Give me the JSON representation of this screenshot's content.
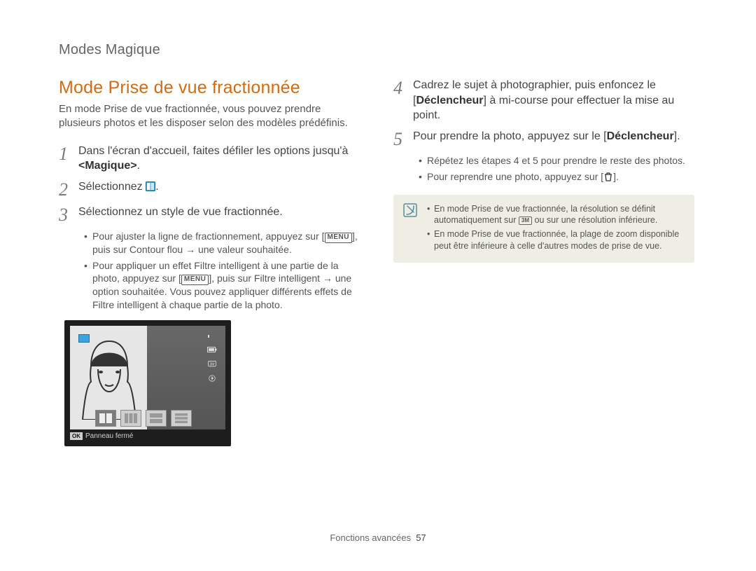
{
  "breadcrumb": "Modes Magique",
  "title": "Mode Prise de vue fractionnée",
  "intro": "En mode Prise de vue fractionnée, vous pouvez prendre plusieurs photos et les disposer selon des modèles prédéfinis.",
  "left": {
    "step1": {
      "pre": "Dans l'écran d'accueil, faites défiler les options jusqu'à ",
      "bold": "<Magique>",
      "post": "."
    },
    "step2": {
      "text": "Sélectionnez "
    },
    "step3": {
      "text": "Sélectionnez un style de vue fractionnée.",
      "bullets": [
        {
          "pre": "Pour ajuster la ligne de fractionnement, appuyez sur [",
          "menu": "MENU",
          "mid": "], puis sur ",
          "bold": "Contour flou",
          "arrow": " → ",
          "post": "une valeur souhaitée."
        },
        {
          "pre": "Pour appliquer un effet Filtre intelligent à une partie de la photo, appuyez sur [",
          "menu": "MENU",
          "mid": "], puis sur ",
          "bold": "Filtre intelligent",
          "arrow": " → ",
          "post": "une option souhaitée. Vous pouvez appliquer différents effets de Filtre intelligent à chaque partie de la photo."
        }
      ]
    },
    "cam_caption": "Panneau fermé"
  },
  "right": {
    "step4": {
      "pre": "Cadrez le sujet à photographier, puis enfoncez le [",
      "bold": "Déclencheur",
      "post": "] à mi-course pour effectuer la mise au point."
    },
    "step5": {
      "pre": "Pour prendre la photo, appuyez sur le [",
      "bold": "Déclencheur",
      "post": "].",
      "bullets": [
        "Répétez les étapes 4 et 5 pour prendre le reste des photos.",
        "Pour reprendre une photo, appuyez sur [     ]."
      ]
    },
    "note": [
      {
        "pre": "En mode Prise de vue fractionnée, la résolution se définit automatiquement sur ",
        "badge": "3M",
        "post": " ou sur une résolution inférieure."
      },
      {
        "pre": "En mode Prise de vue fractionnée, la plage de zoom disponible peut être inférieure à celle d'autres modes de prise de vue.",
        "badge": "",
        "post": ""
      }
    ]
  },
  "footer": {
    "section": "Fonctions avancées",
    "page": "57"
  }
}
